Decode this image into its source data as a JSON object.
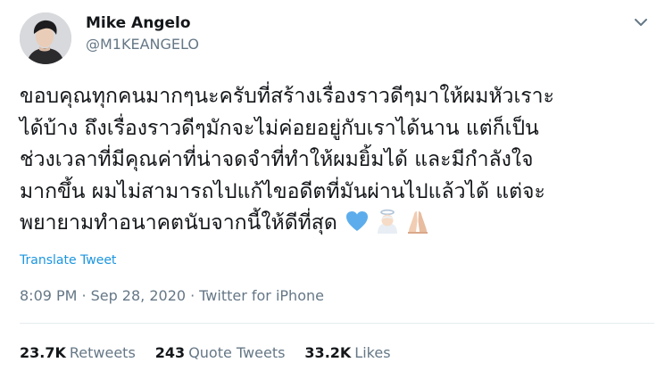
{
  "author": {
    "display_name": "Mike Angelo",
    "handle": "@M1KEANGELO"
  },
  "tweet": {
    "text": "ขอบคุณทุกคนมากๆนะครับที่สร้างเรื่องราวดีๆมาให้ผมหัวเราะ\nได้บ้าง ถึงเรื่องราวดีๆมักจะไม่ค่อยอยู่กับเราได้นาน แต่ก็เป็น\nช่วงเวลาที่มีคุณค่าที่น่าจดจำที่ทำให้ผมยิ้มได้ และมีกำลังใจ\nมากขึ้น ผมไม่สามารถไปแก้ไขอดีตที่มันผ่านไปแล้วได้ แต่จะ\nพยายามทำอนาคตนับจากนี้ให้ดีที่สุด",
    "emojis": [
      "blue-heart-icon",
      "angel-icon",
      "folded-hands-icon"
    ],
    "translate_label": "Translate Tweet",
    "time": "8:09 PM",
    "date": "Sep 28, 2020",
    "separator": "·",
    "source": "Twitter for iPhone"
  },
  "stats": {
    "retweets_count": "23.7K",
    "retweets_label": "Retweets",
    "quotes_count": "243",
    "quotes_label": "Quote Tweets",
    "likes_count": "33.2K",
    "likes_label": "Likes"
  },
  "colors": {
    "link": "#1b95e0",
    "muted": "#657786",
    "text": "#14171a",
    "divider": "#e6ecf0"
  }
}
